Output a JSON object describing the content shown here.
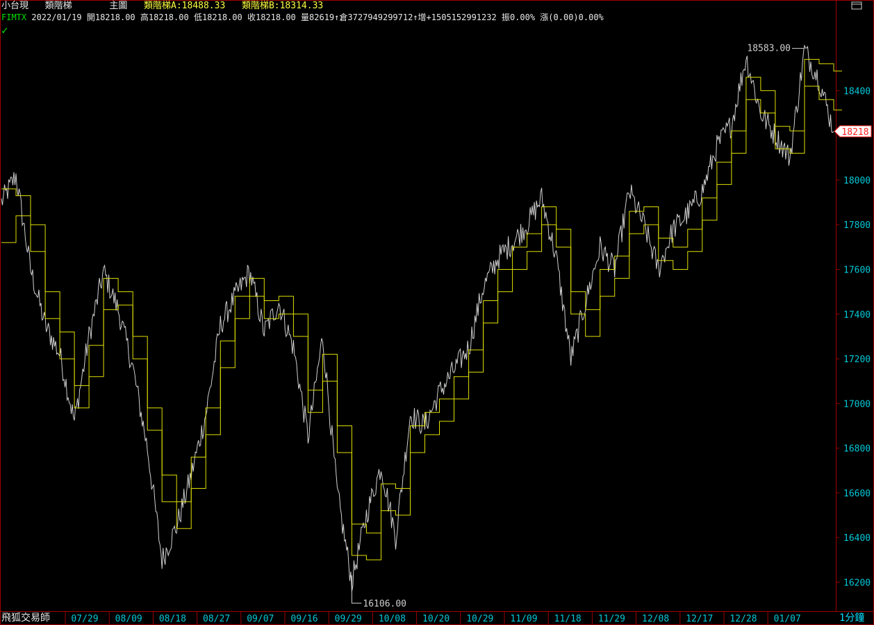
{
  "header": {
    "instrument": "小台現",
    "indicator_name": "類階梯",
    "panel_label": "主圖",
    "indicator_a": "類階梯A:18488.33",
    "indicator_b": "類階梯B:18314.33"
  },
  "quote_line": {
    "symbol": "FIMTX",
    "date": "2022/01/19",
    "open": "開18218.00",
    "high": "高18218.00",
    "low": "低18218.00",
    "close": "收18218.00",
    "volume": "量82619",
    "open_interest": "倉3727949299712",
    "oi_change": "增+1505152991232",
    "amplitude": "振0.00%",
    "change": "漲(0.00)0.00%"
  },
  "footer": {
    "app_name": "飛狐交易師",
    "period": "1分鐘"
  },
  "colors": {
    "background": "#000000",
    "price_line": "#d0d0d0",
    "ladder_lines": "#e0e000",
    "axis_text_right": "#00c8d8",
    "axis_text_bottom": "#00c8d8",
    "frame": "#a00000",
    "header_yellow": "#ffff40",
    "symbol_green": "#00e000",
    "close_flag": "#ff2020"
  },
  "icons": {
    "check": "check-icon",
    "window_toggle": "window-toggle-icon"
  },
  "chart_data": {
    "type": "line",
    "title": "",
    "xlabel": "",
    "ylabel": "",
    "x_tick_labels": [
      "07/29",
      "08/09",
      "08/18",
      "08/27",
      "09/07",
      "09/16",
      "09/29",
      "10/08",
      "10/20",
      "10/29",
      "11/09",
      "11/18",
      "11/29",
      "12/08",
      "12/17",
      "12/28",
      "01/07"
    ],
    "y_tick_labels": [
      "16200",
      "16400",
      "16600",
      "16800",
      "17000",
      "17200",
      "17400",
      "17600",
      "17800",
      "18000",
      "18400"
    ],
    "ylim": [
      16080,
      18700
    ],
    "grid": false,
    "annotations": {
      "max_label": "18583.00",
      "max_value": 18583,
      "min_label": "16106.00",
      "min_value": 16106,
      "last_price_label": "18218",
      "last_price": 18218
    },
    "series": [
      {
        "role": "price",
        "x": [
          "07/21",
          "07/23",
          "07/27",
          "07/29",
          "08/02",
          "08/04",
          "08/06",
          "08/09",
          "08/11",
          "08/13",
          "08/16",
          "08/18",
          "08/20",
          "08/24",
          "08/27",
          "08/31",
          "09/02",
          "09/07",
          "09/09",
          "09/13",
          "09/16",
          "09/22",
          "09/24",
          "09/29",
          "10/01",
          "10/05",
          "10/08",
          "10/13",
          "10/15",
          "10/20",
          "10/25",
          "10/27",
          "10/29",
          "11/02",
          "11/05",
          "11/09",
          "11/11",
          "11/16",
          "11/18",
          "11/22",
          "11/24",
          "11/29",
          "12/01",
          "12/06",
          "12/08",
          "12/10",
          "12/14",
          "12/17",
          "12/21",
          "12/23",
          "12/28",
          "12/30",
          "01/04",
          "01/07",
          "01/11",
          "01/13",
          "01/17",
          "01/19"
        ],
        "values": [
          17900,
          18020,
          17600,
          17350,
          17220,
          16920,
          17300,
          17590,
          17420,
          17160,
          16800,
          16300,
          16450,
          16680,
          16950,
          17350,
          17480,
          17590,
          17320,
          17450,
          17250,
          16850,
          17300,
          16600,
          16200,
          16500,
          16720,
          16400,
          16950,
          16900,
          17050,
          17150,
          17250,
          17520,
          17650,
          17720,
          17800,
          17920,
          17650,
          17200,
          17450,
          17700,
          17600,
          17950,
          17800,
          17600,
          17780,
          17850,
          17950,
          18150,
          18250,
          18550,
          18300,
          18200,
          18100,
          18583,
          18450,
          18218
        ]
      },
      {
        "role": "ladder",
        "name": "類階梯A",
        "x": [
          "07/21",
          "07/23",
          "07/27",
          "07/29",
          "08/02",
          "08/04",
          "08/06",
          "08/09",
          "08/11",
          "08/13",
          "08/16",
          "08/18",
          "08/20",
          "08/24",
          "08/27",
          "08/31",
          "09/02",
          "09/07",
          "09/09",
          "09/13",
          "09/16",
          "09/22",
          "09/24",
          "09/29",
          "10/01",
          "10/05",
          "10/08",
          "10/13",
          "10/15",
          "10/20",
          "10/25",
          "10/27",
          "10/29",
          "11/02",
          "11/05",
          "11/09",
          "11/11",
          "11/16",
          "11/18",
          "11/22",
          "11/24",
          "11/29",
          "12/01",
          "12/06",
          "12/08",
          "12/10",
          "12/14",
          "12/17",
          "12/21",
          "12/23",
          "12/28",
          "12/30",
          "01/04",
          "01/07",
          "01/11",
          "01/13",
          "01/17",
          "01/19"
        ],
        "values": [
          17960,
          17930,
          17800,
          17500,
          17320,
          17080,
          17260,
          17560,
          17500,
          17300,
          16980,
          16680,
          16560,
          16760,
          16980,
          17280,
          17480,
          17560,
          17460,
          17480,
          17400,
          17060,
          17220,
          16900,
          16460,
          16420,
          16640,
          16620,
          16900,
          16960,
          17020,
          17120,
          17240,
          17460,
          17600,
          17700,
          17760,
          17880,
          17780,
          17500,
          17420,
          17600,
          17660,
          17860,
          17880,
          17740,
          17700,
          17780,
          17920,
          18080,
          18220,
          18460,
          18400,
          18240,
          18220,
          18540,
          18520,
          18488
        ]
      },
      {
        "role": "ladder",
        "name": "類階梯B",
        "x": [
          "07/21",
          "07/23",
          "07/27",
          "07/29",
          "08/02",
          "08/04",
          "08/06",
          "08/09",
          "08/11",
          "08/13",
          "08/16",
          "08/18",
          "08/20",
          "08/24",
          "08/27",
          "08/31",
          "09/02",
          "09/07",
          "09/09",
          "09/13",
          "09/16",
          "09/22",
          "09/24",
          "09/29",
          "10/01",
          "10/05",
          "10/08",
          "10/13",
          "10/15",
          "10/20",
          "10/25",
          "10/27",
          "10/29",
          "11/02",
          "11/05",
          "11/09",
          "11/11",
          "11/16",
          "11/18",
          "11/22",
          "11/24",
          "11/29",
          "12/01",
          "12/06",
          "12/08",
          "12/10",
          "12/14",
          "12/17",
          "12/21",
          "12/23",
          "12/28",
          "12/30",
          "01/04",
          "01/07",
          "01/11",
          "01/13",
          "01/17",
          "01/19"
        ],
        "values": [
          17720,
          17840,
          17680,
          17380,
          17200,
          16980,
          17120,
          17420,
          17440,
          17200,
          16880,
          16560,
          16440,
          16620,
          16860,
          17160,
          17380,
          17480,
          17380,
          17400,
          17300,
          16960,
          17100,
          16780,
          16320,
          16300,
          16520,
          16500,
          16780,
          16860,
          16920,
          17020,
          17140,
          17360,
          17500,
          17600,
          17680,
          17800,
          17700,
          17400,
          17300,
          17480,
          17560,
          17760,
          17800,
          17640,
          17600,
          17680,
          17820,
          17980,
          18120,
          18360,
          18300,
          18140,
          18120,
          18420,
          18360,
          18314
        ]
      }
    ]
  }
}
